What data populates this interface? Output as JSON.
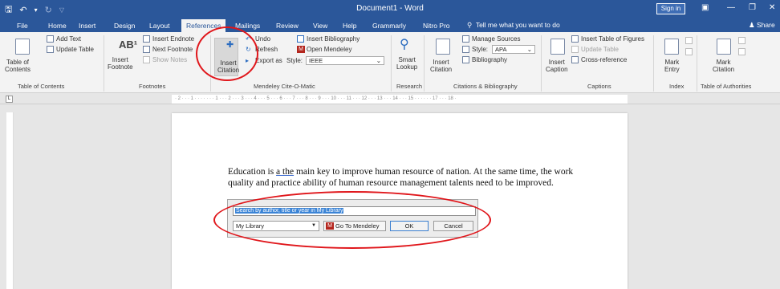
{
  "titlebar": {
    "doc_title": "Document1 - Word",
    "sign_in": "Sign in",
    "qat": {
      "save_icon": "save-icon",
      "undo_icon": "undo-icon",
      "redo_icon": "redo-icon"
    },
    "controls": {
      "ribbon_display": "▣",
      "minimize": "—",
      "restore": "❐",
      "close": "✕"
    }
  },
  "tabs": [
    {
      "label": "File"
    },
    {
      "label": "Home"
    },
    {
      "label": "Insert"
    },
    {
      "label": "Design"
    },
    {
      "label": "Layout"
    },
    {
      "label": "References"
    },
    {
      "label": "Mailings"
    },
    {
      "label": "Review"
    },
    {
      "label": "View"
    },
    {
      "label": "Help"
    },
    {
      "label": "Grammarly"
    },
    {
      "label": "Nitro Pro"
    }
  ],
  "active_tab": "References",
  "tell_me": "Tell me what you want to do",
  "share": "Share",
  "ribbon": {
    "toc": {
      "table_of_contents": "Table of\nContents",
      "add_text": "Add Text",
      "update_table": "Update Table",
      "group": "Table of Contents"
    },
    "footnotes": {
      "ab_glyph": "AB¹",
      "insert_footnote": "Insert\nFootnote",
      "insert_endnote": "Insert Endnote",
      "next_footnote": "Next Footnote",
      "show_notes": "Show Notes",
      "group": "Footnotes"
    },
    "mendeley": {
      "insert_citation": "Insert\nCitation",
      "undo": "Undo",
      "refresh": "Refresh",
      "export_as": "Export as",
      "insert_bibliography": "Insert Bibliography",
      "open_mendeley": "Open Mendeley",
      "style_label": "Style:",
      "style_value": "IEEE",
      "group": "Mendeley Cite-O-Matic"
    },
    "research": {
      "smart_lookup": "Smart\nLookup",
      "group": "Research"
    },
    "citations": {
      "insert_citation": "Insert\nCitation",
      "manage_sources": "Manage Sources",
      "style_label": "Style:",
      "style_value": "APA",
      "bibliography": "Bibliography",
      "group": "Citations & Bibliography"
    },
    "captions": {
      "insert_caption": "Insert\nCaption",
      "insert_table_of_figures": "Insert Table of Figures",
      "update_table": "Update Table",
      "cross_reference": "Cross-reference",
      "group": "Captions"
    },
    "index": {
      "mark_entry": "Mark\nEntry",
      "group": "Index"
    },
    "authorities": {
      "mark_citation": "Mark\nCitation",
      "group": "Table of Authorities"
    }
  },
  "ruler": {
    "corner": "L",
    "marks": "· 2 · · · 1 · · · · · · · 1 · · · 2 · · · 3 · · · 4 · · · 5 · · · 6 · · · 7 · · · 8 · · · 9 · · · 10 · · · 11 · · · 12 · · · 13 · · · 14 · · · 15 · · · · · · 17 · · · 18 ·"
  },
  "document": {
    "text_before": "Education is ",
    "text_underlined": "a the",
    "text_after": " main key to improve human resource of nation. At the same time, the work quality and practice ability of human resource management talents need to be improved."
  },
  "mendeley_dialog": {
    "search_placeholder": "Search by author, title or year in My Library",
    "library_value": "My Library",
    "go_to_mendeley": "Go To Mendeley",
    "ok": "OK",
    "cancel": "Cancel"
  },
  "colors": {
    "word_blue": "#2b579a",
    "annotation_red": "#e0161b",
    "mendeley_red": "#b3261e"
  }
}
